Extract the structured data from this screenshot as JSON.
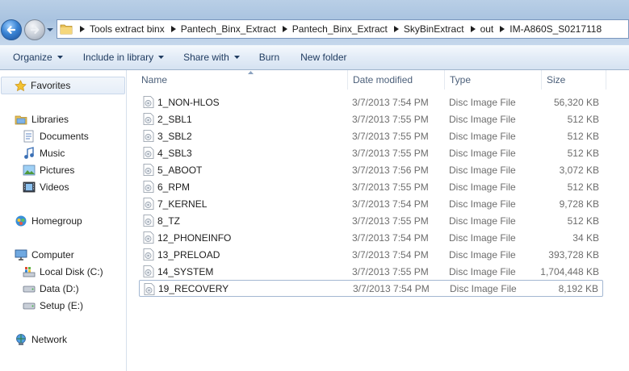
{
  "address": {
    "crumbs": [
      "Tools extract binx",
      "Pantech_Binx_Extract",
      "Pantech_Binx_Extract",
      "SkyBinExtract",
      "out",
      "IM-A860S_S0217118"
    ]
  },
  "toolbar": {
    "organize": "Organize",
    "include_in_library": "Include in library",
    "share_with": "Share with",
    "burn": "Burn",
    "new_folder": "New folder"
  },
  "nav": {
    "favorites": "Favorites",
    "libraries": "Libraries",
    "documents": "Documents",
    "music": "Music",
    "pictures": "Pictures",
    "videos": "Videos",
    "homegroup": "Homegroup",
    "computer": "Computer",
    "local_disk": "Local Disk (C:)",
    "data_drive": "Data (D:)",
    "setup_drive": "Setup (E:)",
    "network": "Network"
  },
  "columns": {
    "name": "Name",
    "date_modified": "Date modified",
    "type": "Type",
    "size": "Size"
  },
  "files": [
    {
      "name": "1_NON-HLOS",
      "date": "3/7/2013 7:54 PM",
      "type": "Disc Image File",
      "size": "56,320 KB"
    },
    {
      "name": "2_SBL1",
      "date": "3/7/2013 7:55 PM",
      "type": "Disc Image File",
      "size": "512 KB"
    },
    {
      "name": "3_SBL2",
      "date": "3/7/2013 7:55 PM",
      "type": "Disc Image File",
      "size": "512 KB"
    },
    {
      "name": "4_SBL3",
      "date": "3/7/2013 7:55 PM",
      "type": "Disc Image File",
      "size": "512 KB"
    },
    {
      "name": "5_ABOOT",
      "date": "3/7/2013 7:56 PM",
      "type": "Disc Image File",
      "size": "3,072 KB"
    },
    {
      "name": "6_RPM",
      "date": "3/7/2013 7:55 PM",
      "type": "Disc Image File",
      "size": "512 KB"
    },
    {
      "name": "7_KERNEL",
      "date": "3/7/2013 7:54 PM",
      "type": "Disc Image File",
      "size": "9,728 KB"
    },
    {
      "name": "8_TZ",
      "date": "3/7/2013 7:55 PM",
      "type": "Disc Image File",
      "size": "512 KB"
    },
    {
      "name": "12_PHONEINFO",
      "date": "3/7/2013 7:54 PM",
      "type": "Disc Image File",
      "size": "34 KB"
    },
    {
      "name": "13_PRELOAD",
      "date": "3/7/2013 7:54 PM",
      "type": "Disc Image File",
      "size": "393,728 KB"
    },
    {
      "name": "14_SYSTEM",
      "date": "3/7/2013 7:55 PM",
      "type": "Disc Image File",
      "size": "1,704,448 KB"
    },
    {
      "name": "19_RECOVERY",
      "date": "3/7/2013 7:54 PM",
      "type": "Disc Image File",
      "size": "8,192 KB"
    }
  ],
  "selected_file_index": 11,
  "icons": {
    "file": "disc-image-file-icon",
    "back": "back-arrow-icon",
    "forward": "forward-arrow-icon"
  },
  "colors": {
    "toolbar_text": "#1e3a5f",
    "column_header_text": "#4c607a",
    "selection_border": "#a3b7d2"
  }
}
